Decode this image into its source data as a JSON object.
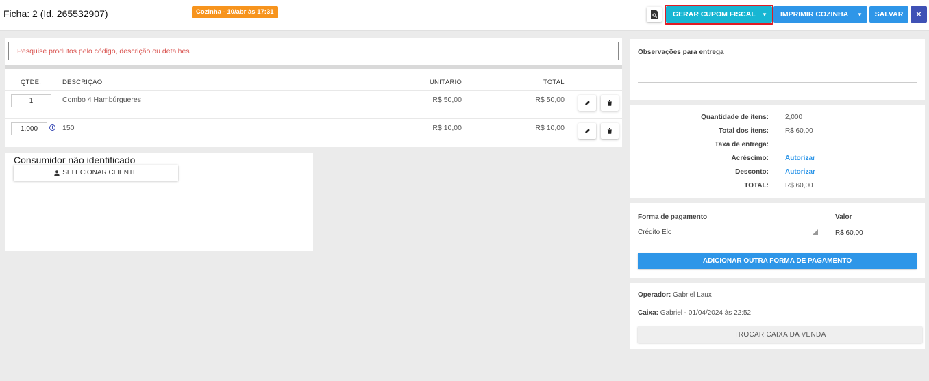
{
  "header": {
    "ficha_title": "Ficha: 2 (Id. 265532907)",
    "kitchen_badge": "Cozinha - 10/abr às 17:31",
    "btn_cupom": "GERAR CUPOM FISCAL",
    "btn_imprimir": "IMPRIMIR COZINHA",
    "btn_salvar": "SALVAR",
    "btn_close": "✕"
  },
  "search": {
    "placeholder": "Pesquise produtos pelo código, descrição ou detalhes"
  },
  "items": {
    "columns": {
      "qtd": "QTDE.",
      "descricao": "DESCRIÇÃO",
      "unitario": "UNITÁRIO",
      "total": "TOTAL"
    },
    "rows": [
      {
        "qtd": "1",
        "descricao": "Combo 4 Hambúrgueres",
        "unitario": "R$ 50,00",
        "total": "R$ 50,00",
        "info": false
      },
      {
        "qtd": "1,000",
        "descricao": "150",
        "unitario": "R$ 10,00",
        "total": "R$ 10,00",
        "info": true
      }
    ]
  },
  "customer": {
    "title": "Consumidor não identificado",
    "select_button": "SELECIONAR CLIENTE"
  },
  "delivery": {
    "obs_label": "Observações para entrega"
  },
  "summary": {
    "rows": [
      {
        "label": "Quantidade de itens:",
        "value": "2,000",
        "link": false
      },
      {
        "label": "Total dos itens:",
        "value": "R$ 60,00",
        "link": false
      },
      {
        "label": "Taxa de entrega:",
        "value": "",
        "link": false
      },
      {
        "label": "Acréscimo:",
        "value": "Autorizar",
        "link": true
      },
      {
        "label": "Desconto:",
        "value": "Autorizar",
        "link": true
      },
      {
        "label": "TOTAL:",
        "value": "R$ 60,00",
        "link": false
      }
    ]
  },
  "payment": {
    "method_header": "Forma de pagamento",
    "value_header": "Valor",
    "method": "Crédito Elo",
    "value": "R$ 60,00",
    "add_button": "ADICIONAR OUTRA FORMA DE PAGAMENTO"
  },
  "operator": {
    "operador_label": "Operador:",
    "operador_value": "Gabriel Laux",
    "caixa_label": "Caixa:",
    "caixa_value": "Gabriel - 01/04/2024 às 22:52",
    "swap_button": "TROCAR CAIXA DA VENDA"
  },
  "colors": {
    "cupom": "#17b6d3",
    "primary": "#2e96e8",
    "close": "#3f51b5",
    "badge": "#f7941d",
    "highlight": "#e01b24"
  },
  "icons": {
    "preview": "search-document-icon",
    "edit": "pencil-icon",
    "delete": "trash-icon",
    "info": "info-icon",
    "user": "person-icon"
  }
}
